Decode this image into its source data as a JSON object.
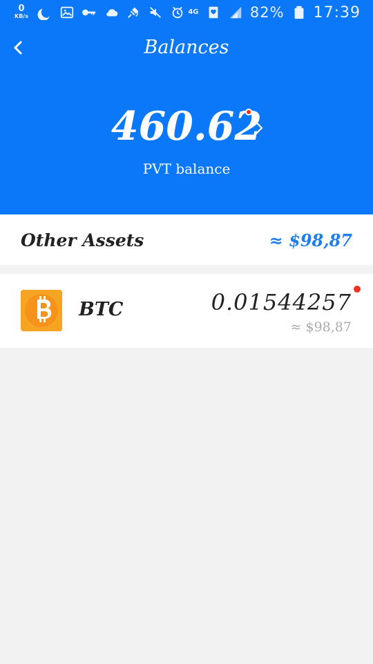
{
  "status_bar": {
    "network_speed_value": "0",
    "network_speed_unit": "KB/s",
    "network_type_top": "4G",
    "battery_percent": "82%",
    "time": "17:39",
    "icons": [
      "moon-icon",
      "image-icon",
      "key-icon",
      "cloud-icon",
      "satellite-icon",
      "mute-icon",
      "alarm-icon",
      "signal-icon",
      "battery-icon"
    ]
  },
  "navigation": {
    "title": "Balances",
    "back_icon": "chevron-left-icon"
  },
  "balance": {
    "value": "460.62",
    "label": "PVT balance",
    "indicator_color": "#ff2f1f",
    "chevron_icon": "chevron-right-icon"
  },
  "assets": {
    "title": "Other Assets",
    "total": "≈ $98,87",
    "total_color": "#1f7ff2",
    "items": [
      {
        "symbol": "BTC",
        "amount": "0.01544257",
        "fiat": "≈ $98,87",
        "icon": "bitcoin-icon",
        "icon_color": "#f5a424"
      }
    ]
  },
  "colors": {
    "header_blue": "#0a78f8",
    "page_background": "#f2f2f2",
    "card_background": "#ffffff",
    "dark_text": "#222222",
    "muted_text": "#aaaaaa",
    "alert_red": "#ff2f1f"
  }
}
